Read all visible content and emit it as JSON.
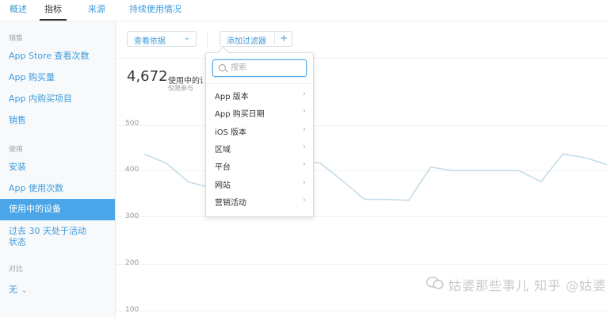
{
  "tabs": [
    {
      "label": "概述"
    },
    {
      "label": "指标"
    },
    {
      "label": "来源"
    },
    {
      "label": "持续使用情况"
    }
  ],
  "sidebar": {
    "sec_sales": "销售",
    "items_sales": [
      "App Store 查看次数",
      "App 购买量",
      "App 内购买项目",
      "销售"
    ],
    "sec_usage": "使用",
    "items_usage": [
      "安装",
      "App 使用次数",
      "使用中的设备",
      "过去 30 天处于活动状态"
    ],
    "sec_compare": "对比",
    "compare_value": "无"
  },
  "toolbar": {
    "view_by": "查看依据",
    "add_filter": "添加过滤器",
    "plus": "+"
  },
  "metric": {
    "value": "4,672",
    "label": "使用中的设备",
    "sub": "仅限参与"
  },
  "dropdown": {
    "search_placeholder": "搜索",
    "items": [
      "App 版本",
      "App 购买日期",
      "iOS 版本",
      "区域",
      "平台",
      "网站",
      "营销活动"
    ]
  },
  "chart_data": {
    "type": "line",
    "yticks": [
      "500",
      "400",
      "300",
      "200",
      "100"
    ],
    "ylim": [
      100,
      500
    ],
    "series": [
      {
        "values": [
          438,
          418,
          378,
          365,
          392,
          400,
          396,
          425,
          418,
          380,
          340,
          340,
          338,
          410,
          402,
          402,
          402,
          402,
          378,
          438,
          430,
          415
        ]
      }
    ],
    "line_color": "#c5dce8"
  },
  "watermark": "姑婆那些事儿 知乎 @姑婆"
}
